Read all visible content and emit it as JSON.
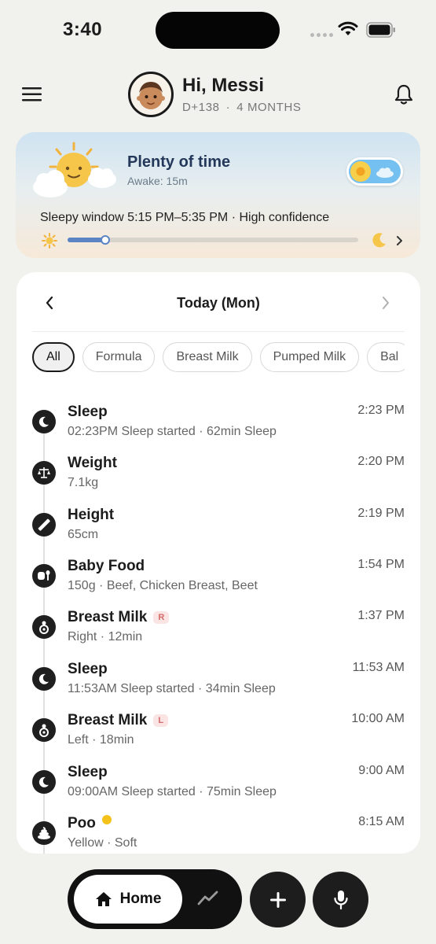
{
  "status_bar": {
    "time": "3:40"
  },
  "header": {
    "greeting": "Hi, Messi",
    "day_count": "D+138",
    "separator": "·",
    "age": "4 MONTHS",
    "icons": [
      "menu-icon",
      "avatar",
      "bell-icon"
    ]
  },
  "sleep_card": {
    "title": "Plenty of time",
    "awake": "Awake: 15m",
    "window": "Sleepy window 5:15 PM–5:35 PM · High confidence",
    "progress_fraction": 0.13,
    "colors": {
      "title": "#24385a",
      "progress": "#5a84c4"
    }
  },
  "log": {
    "date_label": "Today (Mon)",
    "filters": [
      "All",
      "Formula",
      "Breast Milk",
      "Pumped Milk",
      "Bal"
    ],
    "active_filter": "All",
    "entries": [
      {
        "type": "sleep",
        "title": "Sleep",
        "detail": "02:23PM Sleep started · 62min Sleep",
        "time": "2:23 PM"
      },
      {
        "type": "weight",
        "title": "Weight",
        "detail": "7.1kg",
        "time": "2:20 PM"
      },
      {
        "type": "height",
        "title": "Height",
        "detail": "65cm",
        "time": "2:19 PM"
      },
      {
        "type": "baby-food",
        "title": "Baby Food",
        "detail": "150g · Beef, Chicken Breast, Beet",
        "time": "1:54 PM"
      },
      {
        "type": "breast-milk",
        "title": "Breast Milk",
        "badge": "R",
        "detail": "Right · 12min",
        "time": "1:37 PM"
      },
      {
        "type": "sleep",
        "title": "Sleep",
        "detail": "11:53AM Sleep started · 34min Sleep",
        "time": "11:53 AM"
      },
      {
        "type": "breast-milk",
        "title": "Breast Milk",
        "badge": "L",
        "detail": "Left · 18min",
        "time": "10:00 AM"
      },
      {
        "type": "sleep",
        "title": "Sleep",
        "detail": "09:00AM Sleep started · 75min Sleep",
        "time": "9:00 AM"
      },
      {
        "type": "poo",
        "title": "Poo",
        "detail": "Yellow · Soft",
        "time": "8:15 AM"
      }
    ]
  },
  "bottom_nav": {
    "home_label": "Home",
    "icons": [
      "home-icon",
      "trend-icon",
      "add-icon",
      "mic-icon"
    ]
  }
}
